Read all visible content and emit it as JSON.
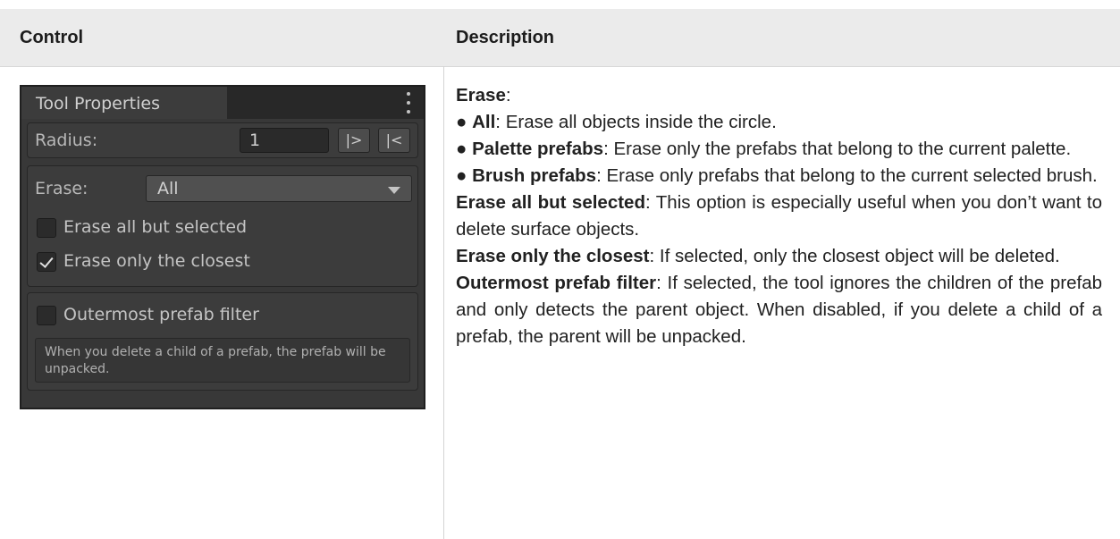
{
  "table": {
    "headers": [
      "Control",
      "Description"
    ]
  },
  "panel": {
    "tab_label": "Tool Properties",
    "radius_label": "Radius:",
    "radius_value": "1",
    "btn_expand": "|>",
    "btn_collapse": "|<",
    "erase_label": "Erase:",
    "erase_value": "All",
    "check_all_but_selected": {
      "label": "Erase all but selected",
      "checked": false
    },
    "check_only_closest": {
      "label": "Erase only the closest",
      "checked": true
    },
    "check_outermost": {
      "label": "Outermost prefab filter",
      "checked": false
    },
    "help_text": "When you delete a child of a prefab, the prefab will be unpacked."
  },
  "description": {
    "erase_title": "Erase",
    "erase_title_suffix": ":",
    "bullets": [
      {
        "term": "All",
        "text": ": Erase all objects inside the circle."
      },
      {
        "term": "Palette prefabs",
        "text": ": Erase only the prefabs that belong to the current palette."
      },
      {
        "term": "Brush prefabs",
        "text": ": Erase only prefabs that belong to the current selected brush."
      }
    ],
    "bullet_glyph": "●",
    "paragraphs": [
      {
        "term": "Erase all but selected",
        "text": ": This option is especially useful when you don’t want to delete surface objects."
      },
      {
        "term": "Erase only the closest",
        "text": ": If selected, only the closest object will be deleted."
      },
      {
        "term": "Outermost prefab filter",
        "text": ": If selected, the tool ignores the children of the prefab and only detects the parent object. When disabled, if you delete a child of a prefab, the parent will be unpacked."
      }
    ]
  }
}
